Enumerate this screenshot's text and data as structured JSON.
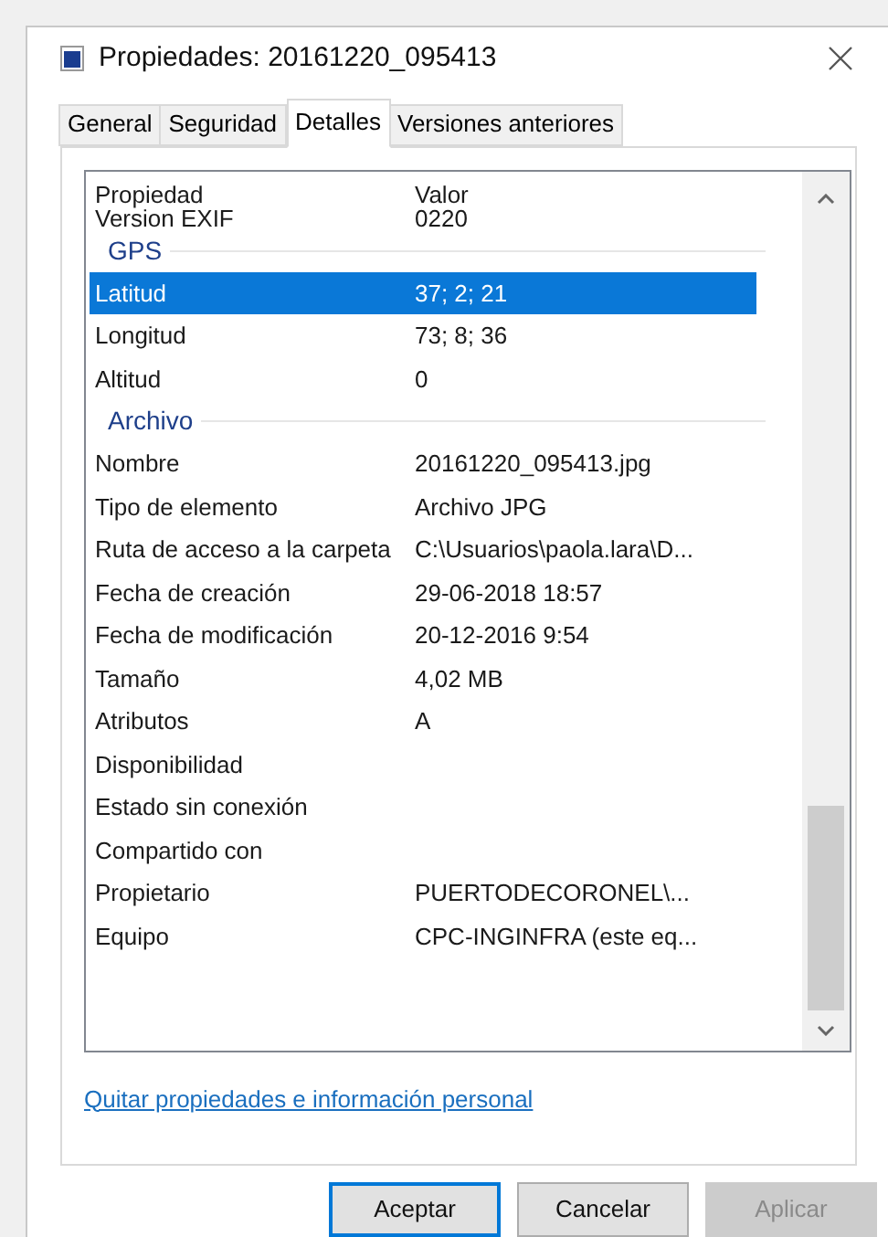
{
  "window": {
    "title": "Propiedades: 20161220_095413"
  },
  "tabs": [
    {
      "label": "General",
      "selected": false
    },
    {
      "label": "Seguridad",
      "selected": false
    },
    {
      "label": "Detalles",
      "selected": true
    },
    {
      "label": "Versiones anteriores",
      "selected": false
    }
  ],
  "table": {
    "columns": [
      "Propiedad",
      "Valor"
    ],
    "rows": [
      {
        "kind": "partial",
        "name": "Version EXIF",
        "value": "0220",
        "selected": false
      },
      {
        "kind": "group",
        "name": "GPS"
      },
      {
        "kind": "row",
        "name": "Latitud",
        "value": "37; 2; 21",
        "selected": true
      },
      {
        "kind": "row",
        "name": "Longitud",
        "value": "73; 8; 36",
        "selected": false
      },
      {
        "kind": "row",
        "name": "Altitud",
        "value": "0",
        "selected": false
      },
      {
        "kind": "group",
        "name": "Archivo"
      },
      {
        "kind": "row",
        "name": "Nombre",
        "value": "20161220_095413.jpg",
        "selected": false
      },
      {
        "kind": "row",
        "name": "Tipo de elemento",
        "value": "Archivo JPG",
        "selected": false
      },
      {
        "kind": "row",
        "name": "Ruta de acceso a la carpeta",
        "value": "C:\\Usuarios\\paola.lara\\D...",
        "selected": false
      },
      {
        "kind": "row",
        "name": "Fecha de creación",
        "value": "29-06-2018 18:57",
        "selected": false
      },
      {
        "kind": "row",
        "name": "Fecha de modificación",
        "value": "20-12-2016 9:54",
        "selected": false
      },
      {
        "kind": "row",
        "name": "Tamaño",
        "value": "4,02 MB",
        "selected": false
      },
      {
        "kind": "row",
        "name": "Atributos",
        "value": "A",
        "selected": false
      },
      {
        "kind": "row",
        "name": "Disponibilidad",
        "value": "",
        "selected": false
      },
      {
        "kind": "row",
        "name": "Estado sin conexión",
        "value": "",
        "selected": false
      },
      {
        "kind": "row",
        "name": "Compartido con",
        "value": "",
        "selected": false
      },
      {
        "kind": "row",
        "name": "Propietario",
        "value": "PUERTODECORONEL\\...",
        "selected": false
      },
      {
        "kind": "row",
        "name": "Equipo",
        "value": "CPC-INGINFRA (este eq...",
        "selected": false
      }
    ]
  },
  "link": "Quitar propiedades e información personal",
  "buttons": [
    {
      "label": "Aceptar",
      "kind": "default",
      "disabled": false
    },
    {
      "label": "Cancelar",
      "kind": "normal",
      "disabled": false
    },
    {
      "label": "Aplicar",
      "kind": "normal",
      "disabled": true
    }
  ]
}
